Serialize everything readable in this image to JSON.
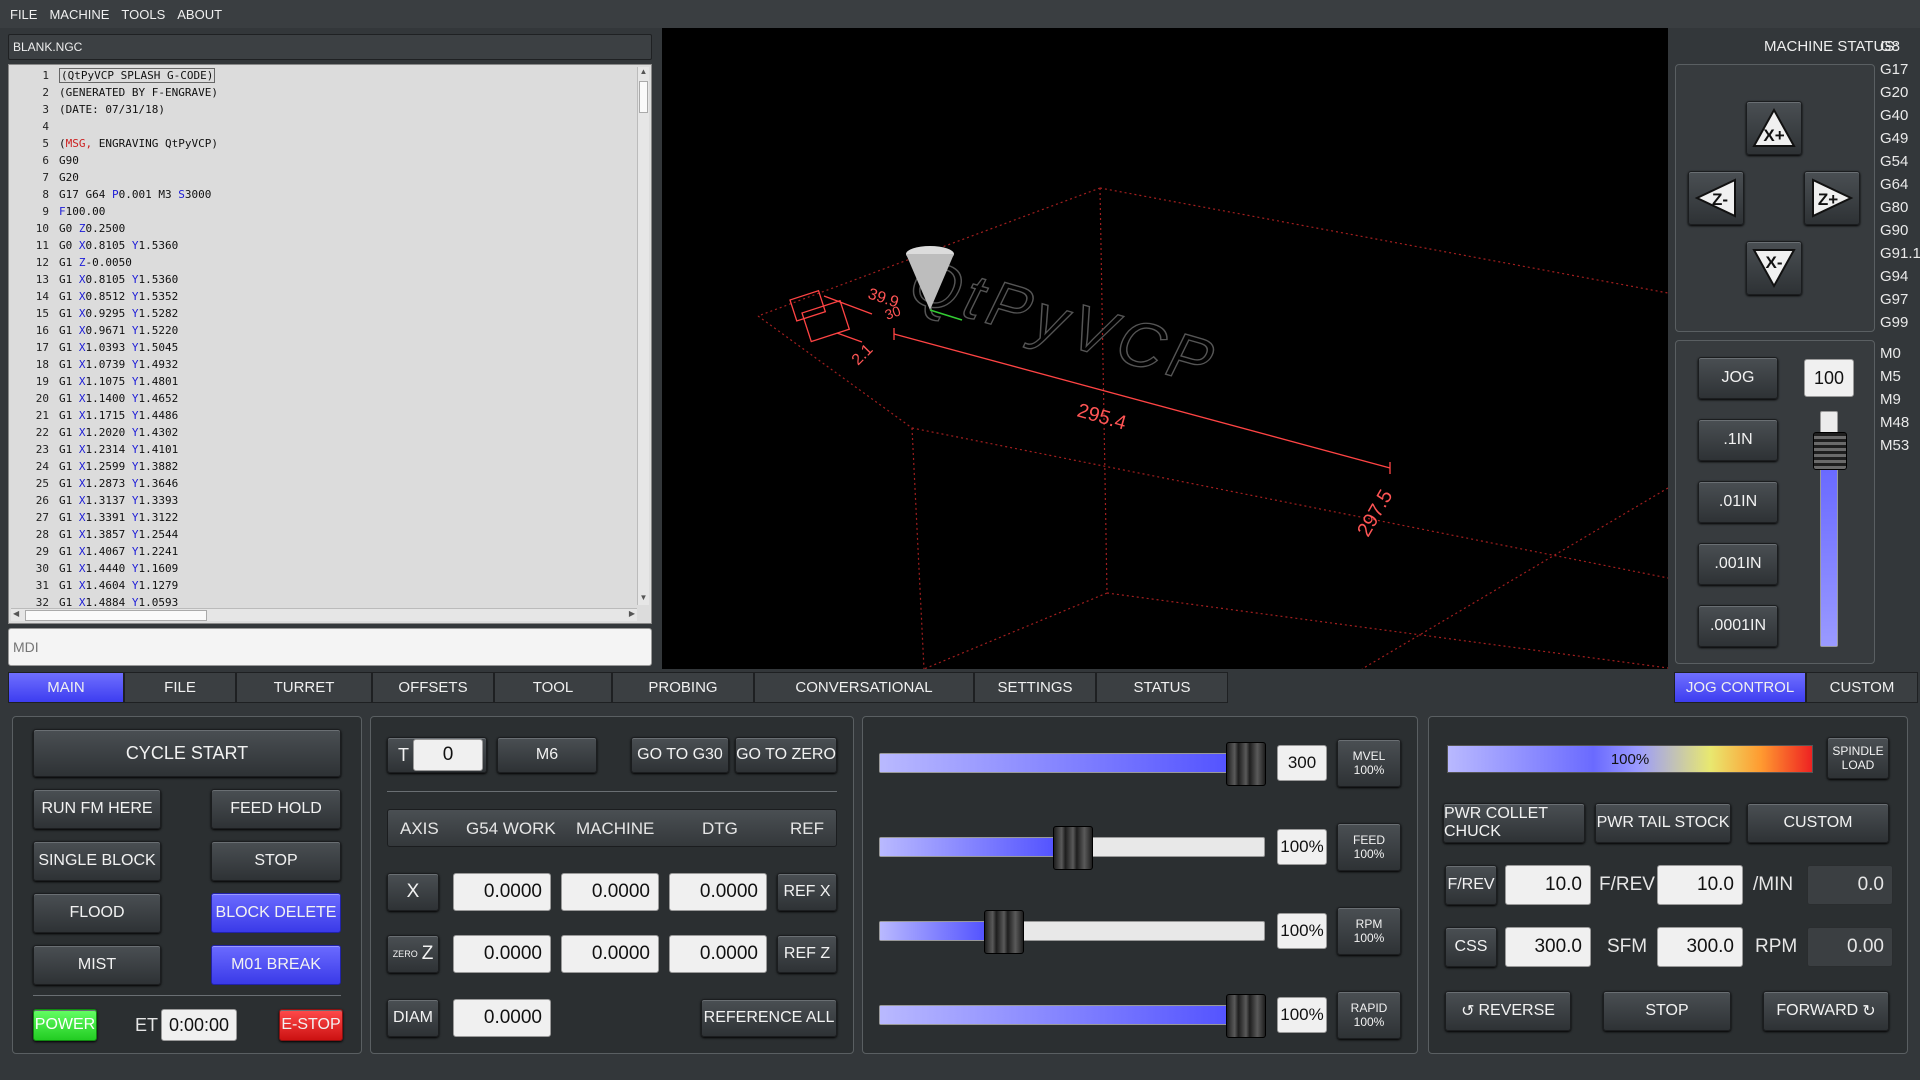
{
  "menu": [
    "FILE",
    "MACHINE",
    "TOOLS",
    "ABOUT"
  ],
  "file_title": "BLANK.NGC",
  "mdi_placeholder": "MDI",
  "code_lines": [
    {
      "n": "1",
      "parts": [
        {
          "t": "(QtPyVCP SPLASH G-CODE)",
          "c": "g"
        }
      ]
    },
    {
      "n": "2",
      "parts": [
        {
          "t": "(GENERATED BY F-ENGRAVE)",
          "c": "g"
        }
      ]
    },
    {
      "n": "3",
      "parts": [
        {
          "t": "(DATE: 07/31/18)",
          "c": "g"
        }
      ]
    },
    {
      "n": "4",
      "parts": [
        {
          "t": "",
          "c": "g"
        }
      ]
    },
    {
      "n": "5",
      "parts": [
        {
          "t": "(",
          "c": "g"
        },
        {
          "t": "MSG,",
          "c": "msg"
        },
        {
          "t": " ENGRAVING QtPyVCP)",
          "c": "g"
        }
      ]
    },
    {
      "n": "6",
      "parts": [
        {
          "t": "G90",
          "c": "g"
        }
      ]
    },
    {
      "n": "7",
      "parts": [
        {
          "t": "G20",
          "c": "g"
        }
      ]
    },
    {
      "n": "8",
      "parts": [
        {
          "t": "G17 G64 ",
          "c": "g"
        },
        {
          "t": "P",
          "c": "kw"
        },
        {
          "t": "0.001 ",
          "c": "g"
        },
        {
          "t": "M3",
          "c": "g"
        },
        {
          "t": " S",
          "c": "kw"
        },
        {
          "t": "3000",
          "c": "g"
        }
      ]
    },
    {
      "n": "9",
      "parts": [
        {
          "t": "F",
          "c": "kw"
        },
        {
          "t": "100.00",
          "c": "g"
        }
      ]
    },
    {
      "n": "10",
      "parts": [
        {
          "t": "G0 ",
          "c": "g"
        },
        {
          "t": "Z",
          "c": "kw"
        },
        {
          "t": "0.2500",
          "c": "g"
        }
      ]
    },
    {
      "n": "11",
      "parts": [
        {
          "t": "G0 ",
          "c": "g"
        },
        {
          "t": "X",
          "c": "kw"
        },
        {
          "t": "0.8105 ",
          "c": "g"
        },
        {
          "t": "Y",
          "c": "kw"
        },
        {
          "t": "1.5360",
          "c": "g"
        }
      ]
    },
    {
      "n": "12",
      "parts": [
        {
          "t": "G1 ",
          "c": "g"
        },
        {
          "t": "Z",
          "c": "kw"
        },
        {
          "t": "-0.0050",
          "c": "g"
        }
      ]
    },
    {
      "n": "13",
      "parts": [
        {
          "t": "G1 ",
          "c": "g"
        },
        {
          "t": "X",
          "c": "kw"
        },
        {
          "t": "0.8105 ",
          "c": "g"
        },
        {
          "t": "Y",
          "c": "kw"
        },
        {
          "t": "1.5360",
          "c": "g"
        }
      ]
    },
    {
      "n": "14",
      "parts": [
        {
          "t": "G1 ",
          "c": "g"
        },
        {
          "t": "X",
          "c": "kw"
        },
        {
          "t": "0.8512 ",
          "c": "g"
        },
        {
          "t": "Y",
          "c": "kw"
        },
        {
          "t": "1.5352",
          "c": "g"
        }
      ]
    },
    {
      "n": "15",
      "parts": [
        {
          "t": "G1 ",
          "c": "g"
        },
        {
          "t": "X",
          "c": "kw"
        },
        {
          "t": "0.9295 ",
          "c": "g"
        },
        {
          "t": "Y",
          "c": "kw"
        },
        {
          "t": "1.5282",
          "c": "g"
        }
      ]
    },
    {
      "n": "16",
      "parts": [
        {
          "t": "G1 ",
          "c": "g"
        },
        {
          "t": "X",
          "c": "kw"
        },
        {
          "t": "0.9671 ",
          "c": "g"
        },
        {
          "t": "Y",
          "c": "kw"
        },
        {
          "t": "1.5220",
          "c": "g"
        }
      ]
    },
    {
      "n": "17",
      "parts": [
        {
          "t": "G1 ",
          "c": "g"
        },
        {
          "t": "X",
          "c": "kw"
        },
        {
          "t": "1.0393 ",
          "c": "g"
        },
        {
          "t": "Y",
          "c": "kw"
        },
        {
          "t": "1.5045",
          "c": "g"
        }
      ]
    },
    {
      "n": "18",
      "parts": [
        {
          "t": "G1 ",
          "c": "g"
        },
        {
          "t": "X",
          "c": "kw"
        },
        {
          "t": "1.0739 ",
          "c": "g"
        },
        {
          "t": "Y",
          "c": "kw"
        },
        {
          "t": "1.4932",
          "c": "g"
        }
      ]
    },
    {
      "n": "19",
      "parts": [
        {
          "t": "G1 ",
          "c": "g"
        },
        {
          "t": "X",
          "c": "kw"
        },
        {
          "t": "1.1075 ",
          "c": "g"
        },
        {
          "t": "Y",
          "c": "kw"
        },
        {
          "t": "1.4801",
          "c": "g"
        }
      ]
    },
    {
      "n": "20",
      "parts": [
        {
          "t": "G1 ",
          "c": "g"
        },
        {
          "t": "X",
          "c": "kw"
        },
        {
          "t": "1.1400 ",
          "c": "g"
        },
        {
          "t": "Y",
          "c": "kw"
        },
        {
          "t": "1.4652",
          "c": "g"
        }
      ]
    },
    {
      "n": "21",
      "parts": [
        {
          "t": "G1 ",
          "c": "g"
        },
        {
          "t": "X",
          "c": "kw"
        },
        {
          "t": "1.1715 ",
          "c": "g"
        },
        {
          "t": "Y",
          "c": "kw"
        },
        {
          "t": "1.4486",
          "c": "g"
        }
      ]
    },
    {
      "n": "22",
      "parts": [
        {
          "t": "G1 ",
          "c": "g"
        },
        {
          "t": "X",
          "c": "kw"
        },
        {
          "t": "1.2020 ",
          "c": "g"
        },
        {
          "t": "Y",
          "c": "kw"
        },
        {
          "t": "1.4302",
          "c": "g"
        }
      ]
    },
    {
      "n": "23",
      "parts": [
        {
          "t": "G1 ",
          "c": "g"
        },
        {
          "t": "X",
          "c": "kw"
        },
        {
          "t": "1.2314 ",
          "c": "g"
        },
        {
          "t": "Y",
          "c": "kw"
        },
        {
          "t": "1.4101",
          "c": "g"
        }
      ]
    },
    {
      "n": "24",
      "parts": [
        {
          "t": "G1 ",
          "c": "g"
        },
        {
          "t": "X",
          "c": "kw"
        },
        {
          "t": "1.2599 ",
          "c": "g"
        },
        {
          "t": "Y",
          "c": "kw"
        },
        {
          "t": "1.3882",
          "c": "g"
        }
      ]
    },
    {
      "n": "25",
      "parts": [
        {
          "t": "G1 ",
          "c": "g"
        },
        {
          "t": "X",
          "c": "kw"
        },
        {
          "t": "1.2873 ",
          "c": "g"
        },
        {
          "t": "Y",
          "c": "kw"
        },
        {
          "t": "1.3646",
          "c": "g"
        }
      ]
    },
    {
      "n": "26",
      "parts": [
        {
          "t": "G1 ",
          "c": "g"
        },
        {
          "t": "X",
          "c": "kw"
        },
        {
          "t": "1.3137 ",
          "c": "g"
        },
        {
          "t": "Y",
          "c": "kw"
        },
        {
          "t": "1.3393",
          "c": "g"
        }
      ]
    },
    {
      "n": "27",
      "parts": [
        {
          "t": "G1 ",
          "c": "g"
        },
        {
          "t": "X",
          "c": "kw"
        },
        {
          "t": "1.3391 ",
          "c": "g"
        },
        {
          "t": "Y",
          "c": "kw"
        },
        {
          "t": "1.3122",
          "c": "g"
        }
      ]
    },
    {
      "n": "28",
      "parts": [
        {
          "t": "G1 ",
          "c": "g"
        },
        {
          "t": "X",
          "c": "kw"
        },
        {
          "t": "1.3857 ",
          "c": "g"
        },
        {
          "t": "Y",
          "c": "kw"
        },
        {
          "t": "1.2544",
          "c": "g"
        }
      ]
    },
    {
      "n": "29",
      "parts": [
        {
          "t": "G1 ",
          "c": "g"
        },
        {
          "t": "X",
          "c": "kw"
        },
        {
          "t": "1.4067 ",
          "c": "g"
        },
        {
          "t": "Y",
          "c": "kw"
        },
        {
          "t": "1.2241",
          "c": "g"
        }
      ]
    },
    {
      "n": "30",
      "parts": [
        {
          "t": "G1 ",
          "c": "g"
        },
        {
          "t": "X",
          "c": "kw"
        },
        {
          "t": "1.4440 ",
          "c": "g"
        },
        {
          "t": "Y",
          "c": "kw"
        },
        {
          "t": "1.1609",
          "c": "g"
        }
      ]
    },
    {
      "n": "31",
      "parts": [
        {
          "t": "G1 ",
          "c": "g"
        },
        {
          "t": "X",
          "c": "kw"
        },
        {
          "t": "1.4604 ",
          "c": "g"
        },
        {
          "t": "Y",
          "c": "kw"
        },
        {
          "t": "1.1279",
          "c": "g"
        }
      ]
    },
    {
      "n": "32",
      "parts": [
        {
          "t": "G1 ",
          "c": "g"
        },
        {
          "t": "X",
          "c": "kw"
        },
        {
          "t": "1.4884 ",
          "c": "g"
        },
        {
          "t": "Y",
          "c": "kw"
        },
        {
          "t": "1.0593",
          "c": "g"
        }
      ]
    }
  ],
  "viewer": {
    "dims": [
      "39.9",
      "30",
      "2.1",
      "295.4",
      "297.5"
    ],
    "engraving_text": "QtPyVCP"
  },
  "machine_status": {
    "label": "MACHINE STATUS:",
    "g_codes": [
      "G8",
      "G17",
      "G20",
      "G40",
      "G49",
      "G54",
      "G64",
      "G80",
      "G90",
      "G91.1",
      "G94",
      "G97",
      "G99"
    ],
    "m_codes": [
      "M0",
      "M5",
      "M9",
      "M48",
      "M53"
    ]
  },
  "jog_buttons": {
    "x_plus": "X+",
    "x_minus": "X-",
    "z_plus": "Z+",
    "z_minus": "Z-"
  },
  "jog": {
    "jog_label": "JOG",
    "jog_rate": "100",
    "jog_rate_fraction": 0.9,
    "incs": [
      ".1IN",
      ".01IN",
      ".001IN",
      ".0001IN"
    ]
  },
  "tabs": [
    "MAIN",
    "FILE",
    "TURRET",
    "OFFSETS",
    "TOOL",
    "PROBING",
    "CONVERSATIONAL",
    "SETTINGS",
    "STATUS"
  ],
  "right_tabs": [
    "JOG CONTROL",
    "CUSTOM"
  ],
  "program": {
    "cycle_start": "CYCLE START",
    "run_from_here": "RUN FM HERE",
    "feed_hold": "FEED HOLD",
    "single_block": "SINGLE BLOCK",
    "stop": "STOP",
    "flood": "FLOOD",
    "block_delete": "BLOCK DELETE",
    "mist": "MIST",
    "m01_break": "M01 BREAK",
    "power": "POWER",
    "et_label": "ET",
    "et_value": "0:00:00",
    "estop": "E-STOP"
  },
  "dro": {
    "t_label": "T",
    "tool_number": "0",
    "m6": "M6",
    "go_g30": "GO TO G30",
    "go_zero": "GO TO ZERO",
    "headers": [
      "AXIS",
      "G54 WORK",
      "MACHINE",
      "DTG",
      "REF"
    ],
    "x_label": "X",
    "x_values": [
      "0.0000",
      "0.0000",
      "0.0000"
    ],
    "ref_x": "REF X",
    "zero_label": "ZERO",
    "z_label": "Z",
    "z_values": [
      "0.0000",
      "0.0000",
      "0.0000"
    ],
    "ref_z": "REF Z",
    "diam_label": "DIAM",
    "diam_value": "0.0000",
    "reference_all": "REFERENCE ALL"
  },
  "overrides": [
    {
      "value": "300",
      "btn_top": "MVEL",
      "btn_bottom": "100%",
      "fill": 1.0
    },
    {
      "value": "100%",
      "btn_top": "FEED",
      "btn_bottom": "100%",
      "fill": 0.5
    },
    {
      "value": "100%",
      "btn_top": "RPM",
      "btn_bottom": "100%",
      "fill": 0.3
    },
    {
      "value": "100%",
      "btn_top": "RAPID",
      "btn_bottom": "100%",
      "fill": 1.0
    }
  ],
  "spindle": {
    "load_value": "100%",
    "load_label_top": "SPINDLE",
    "load_label_bottom": "LOAD",
    "pwr_collet": "PWR COLLET CHUCK",
    "pwr_tail": "PWR TAIL STOCK",
    "custom": "CUSTOM",
    "frev_btn": "F/REV",
    "frev_value": "10.0",
    "frev_label": "F/REV",
    "frev_value2": "10.0",
    "min_label": "/MIN",
    "min_value": "0.0",
    "css_btn": "CSS",
    "css_value": "300.0",
    "sfm_label": "SFM",
    "sfm_value": "300.0",
    "rpm_label": "RPM",
    "rpm_value": "0.00",
    "reverse": "REVERSE",
    "stop": "STOP",
    "forward": "FORWARD"
  },
  "colors": {
    "accent_blue": "#4444ff",
    "power_green": "#33dd33",
    "estop_red": "#ee2222"
  }
}
